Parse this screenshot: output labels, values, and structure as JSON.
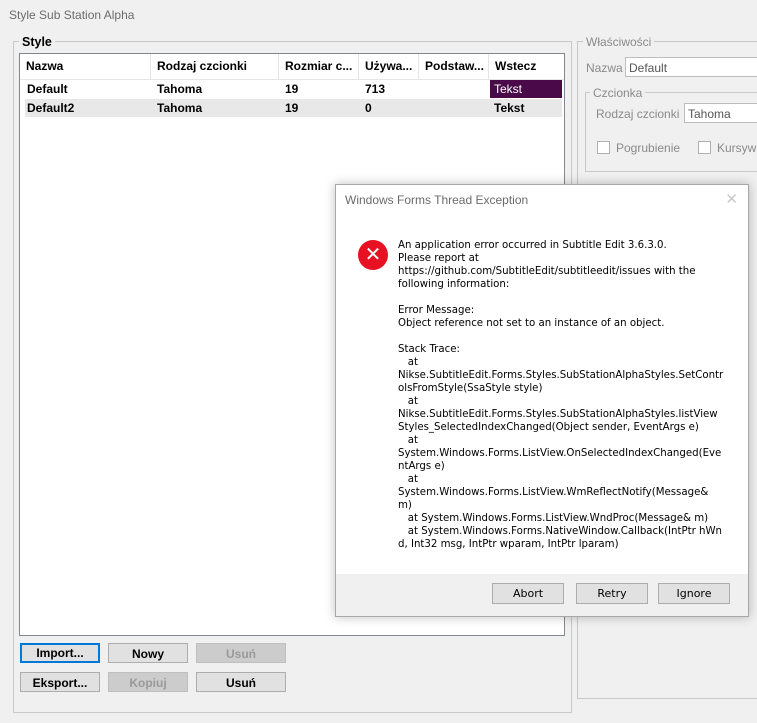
{
  "window": {
    "title": "Style Sub Station Alpha"
  },
  "styles_group": {
    "label": "Style"
  },
  "listview": {
    "columns": [
      "Nazwa",
      "Rodzaj czcionki",
      "Rozmiar c...",
      "Używa...",
      "Podstaw...",
      "Wstecz"
    ],
    "rows": [
      {
        "name": "Default",
        "font": "Tahoma",
        "size": "19",
        "used": "713",
        "base": "",
        "back": "Tekst"
      },
      {
        "name": "Default2",
        "font": "Tahoma",
        "size": "19",
        "used": "0",
        "base": "",
        "back": "Tekst"
      }
    ]
  },
  "buttons": {
    "import": "Import...",
    "new": "Nowy",
    "delete1": "Usuń",
    "export": "Eksport...",
    "copy": "Kopiuj",
    "delete2": "Usuń"
  },
  "properties": {
    "label": "Właściwości",
    "name_label": "Nazwa",
    "name_value": "Default",
    "font_group_label": "Czcionka",
    "font_name_label": "Rodzaj czcionki",
    "font_name_value": "Tahoma",
    "bold_label": "Pogrubienie",
    "italic_label": "Kursywa"
  },
  "dialog": {
    "title": "Windows Forms Thread Exception",
    "icon": "error-icon",
    "message": "An application error occurred in Subtitle Edit 3.6.3.0.\nPlease report at\nhttps://github.com/SubtitleEdit/subtitleedit/issues with the\nfollowing information:\n\nError Message:\nObject reference not set to an instance of an object.\n\nStack Trace:\n   at\nNikse.SubtitleEdit.Forms.Styles.SubStationAlphaStyles.SetControlsFromStyle(SsaStyle style)\n   at\nNikse.SubtitleEdit.Forms.Styles.SubStationAlphaStyles.listViewStyles_SelectedIndexChanged(Object sender, EventArgs e)\n   at\nSystem.Windows.Forms.ListView.OnSelectedIndexChanged(EventArgs e)\n   at\nSystem.Windows.Forms.ListView.WmReflectNotify(Message& m)\n   at System.Windows.Forms.ListView.WndProc(Message& m)\n   at System.Windows.Forms.NativeWindow.Callback(IntPtr hWnd, Int32 msg, IntPtr wparam, IntPtr lparam)",
    "buttons": {
      "abort": "Abort",
      "retry": "Retry",
      "ignore": "Ignore"
    }
  },
  "colors": {
    "accent": "#0078d7",
    "swatch": "#4a0a4a",
    "error": "#e81123"
  }
}
